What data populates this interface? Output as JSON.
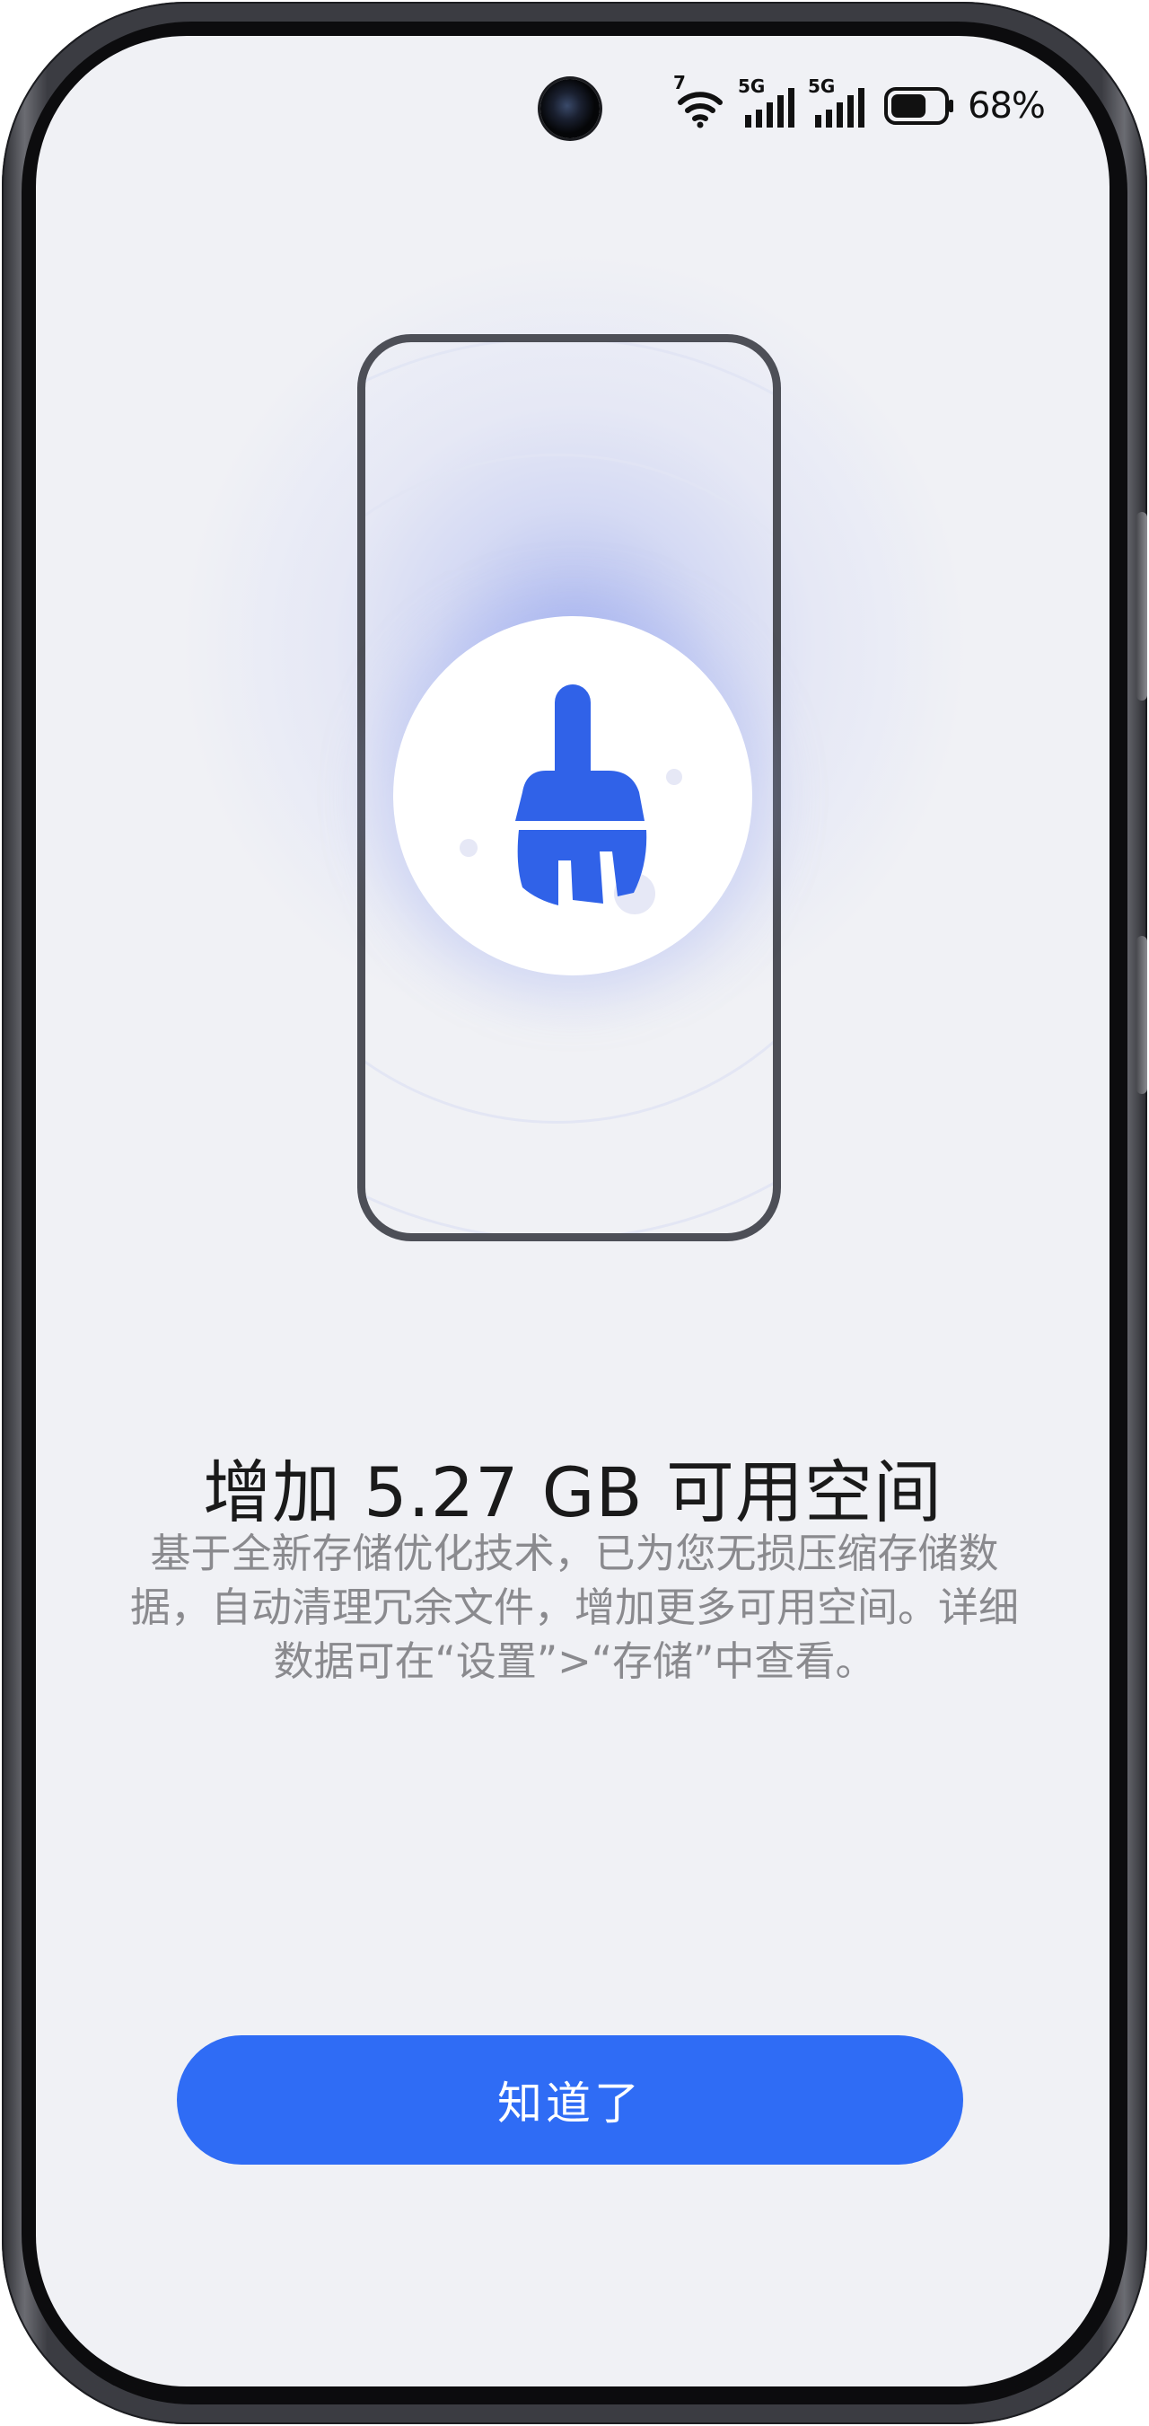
{
  "status_bar": {
    "wifi_badge": "7",
    "sim1_network": "5G",
    "sim2_network": "5G",
    "battery_level": 0.68,
    "battery_percent": "68%",
    "icons": [
      "wifi-icon",
      "signal-icon",
      "signal-icon",
      "battery-icon"
    ]
  },
  "illustration": {
    "icon": "broom-icon",
    "accent_color": "#3062e8"
  },
  "content": {
    "title": "增加 5.27 GB 可用空间",
    "description": "基于全新存储优化技术，已为您无损压缩存储数据，自动清理冗余文件，增加更多可用空间。详细数据可在“设置”>“存储”中查看。"
  },
  "actions": {
    "confirm_label": "知道了",
    "confirm_color": "#2f6cf5"
  }
}
